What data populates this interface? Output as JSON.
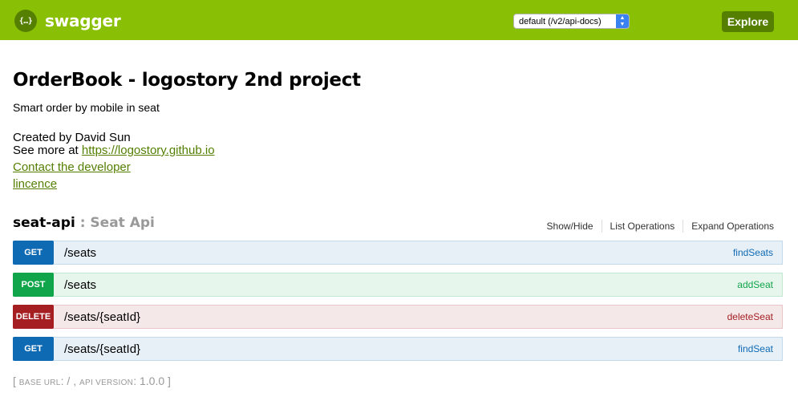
{
  "header": {
    "logo_icon_text": "{…}",
    "logo_text": "swagger",
    "api_select_value": "default (/v2/api-docs)",
    "explore_label": "Explore"
  },
  "info": {
    "title": "OrderBook - logostory 2nd project",
    "description": "Smart order by mobile in seat",
    "created_by": "Created by David Sun",
    "see_more_prefix": "See more at ",
    "see_more_link": "https://logostory.github.io",
    "contact_link": "Contact the developer",
    "licence_link": "lincence"
  },
  "resource": {
    "name": "seat-api",
    "description": ": Seat Api",
    "actions": [
      "Show/Hide",
      "List Operations",
      "Expand Operations"
    ],
    "operations": [
      {
        "method": "GET",
        "path": "/seats",
        "nickname": "findSeats"
      },
      {
        "method": "POST",
        "path": "/seats",
        "nickname": "addSeat"
      },
      {
        "method": "DELETE",
        "path": "/seats/{seatId}",
        "nickname": "deleteSeat"
      },
      {
        "method": "GET",
        "path": "/seats/{seatId}",
        "nickname": "findSeat"
      }
    ]
  },
  "footer": {
    "open_bracket": "[",
    "base_url_label": "base url",
    "base_url_value": ": / , ",
    "api_version_label": "api version",
    "api_version_value": ": 1.0.0 ",
    "close_bracket": "]"
  },
  "colors": {
    "header_bg": "#89bf04",
    "accent_dark": "#547f00",
    "get": "#0f6ab4",
    "post": "#10a54a",
    "delete": "#a41e22"
  }
}
